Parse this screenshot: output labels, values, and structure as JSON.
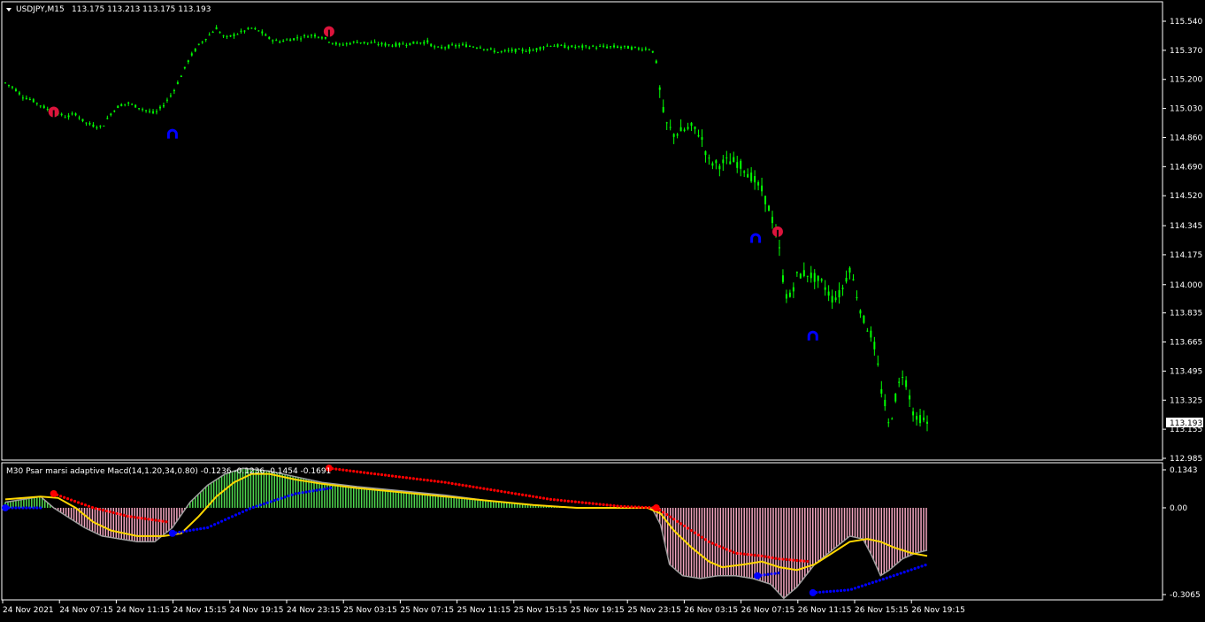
{
  "main_panel": {
    "title": "USDJPY,M15",
    "ohlc": "113.175 113.213 113.175 113.193",
    "current_price": "113.193",
    "y_labels": [
      "115.540",
      "115.370",
      "115.200",
      "115.030",
      "114.860",
      "114.690",
      "114.520",
      "114.345",
      "114.175",
      "114.000",
      "113.835",
      "113.665",
      "113.495",
      "113.325",
      "113.155",
      "112.985"
    ],
    "candle_color": "#00ff00",
    "signal_sell_color": "#dc143c",
    "signal_buy_color": "#0000ff"
  },
  "indicator_panel": {
    "title": "M30 Psar marsi adaptive Macd(14,1.20,34,0.80) -0.1236 -0.1236 -0.1454 -0.1691",
    "y_labels": [
      "0.1343",
      "0.00",
      "-0.3065"
    ]
  },
  "x_labels": [
    "24 Nov 2021",
    "24 Nov 07:15",
    "24 Nov 11:15",
    "24 Nov 15:15",
    "24 Nov 19:15",
    "24 Nov 23:15",
    "25 Nov 03:15",
    "25 Nov 07:15",
    "25 Nov 11:15",
    "25 Nov 15:15",
    "25 Nov 19:15",
    "25 Nov 23:15",
    "26 Nov 03:15",
    "26 Nov 07:15",
    "26 Nov 11:15",
    "26 Nov 15:15",
    "26 Nov 19:15"
  ],
  "colors": {
    "frame": "#ffffff",
    "hist_positive": "#4fd84f",
    "hist_negative": "#f4a6c0",
    "macd_line": "#9e9e9e",
    "signal_line": "#ffd700",
    "psar_red": "#ff0000",
    "psar_blue": "#0000ff"
  },
  "chart_data": [
    {
      "type": "candlestick",
      "title": "USDJPY,M15",
      "ylim": [
        112.985,
        115.54
      ],
      "price_path": [
        [
          0,
          115.18
        ],
        [
          10,
          115.15
        ],
        [
          20,
          115.1
        ],
        [
          30,
          115.08
        ],
        [
          40,
          115.05
        ],
        [
          50,
          115.02
        ],
        [
          60,
          115.0
        ],
        [
          70,
          114.98
        ],
        [
          80,
          115.0
        ],
        [
          90,
          114.95
        ],
        [
          100,
          114.93
        ],
        [
          110,
          114.92
        ],
        [
          120,
          115.0
        ],
        [
          130,
          115.05
        ],
        [
          140,
          115.06
        ],
        [
          150,
          115.04
        ],
        [
          160,
          115.02
        ],
        [
          170,
          115.0
        ],
        [
          180,
          115.05
        ],
        [
          190,
          115.12
        ],
        [
          200,
          115.22
        ],
        [
          210,
          115.33
        ],
        [
          220,
          115.4
        ],
        [
          230,
          115.45
        ],
        [
          240,
          115.5
        ],
        [
          250,
          115.44
        ],
        [
          260,
          115.46
        ],
        [
          270,
          115.48
        ],
        [
          280,
          115.5
        ],
        [
          290,
          115.48
        ],
        [
          300,
          115.44
        ],
        [
          310,
          115.42
        ],
        [
          320,
          115.43
        ],
        [
          330,
          115.44
        ],
        [
          340,
          115.45
        ],
        [
          350,
          115.46
        ],
        [
          360,
          115.45
        ],
        [
          370,
          115.42
        ],
        [
          380,
          115.4
        ],
        [
          390,
          115.41
        ],
        [
          400,
          115.42
        ],
        [
          420,
          115.41
        ],
        [
          440,
          115.4
        ],
        [
          460,
          115.41
        ],
        [
          480,
          115.42
        ],
        [
          490,
          115.38
        ],
        [
          500,
          115.39
        ],
        [
          520,
          115.4
        ],
        [
          540,
          115.39
        ],
        [
          560,
          115.36
        ],
        [
          580,
          115.37
        ],
        [
          600,
          115.37
        ],
        [
          610,
          115.39
        ],
        [
          620,
          115.4
        ],
        [
          640,
          115.39
        ],
        [
          660,
          115.39
        ],
        [
          680,
          115.39
        ],
        [
          700,
          115.39
        ],
        [
          720,
          115.38
        ],
        [
          735,
          115.38
        ],
        [
          740,
          115.3
        ],
        [
          745,
          115.1
        ],
        [
          750,
          114.95
        ],
        [
          760,
          114.88
        ],
        [
          770,
          114.9
        ],
        [
          780,
          114.92
        ],
        [
          790,
          114.88
        ],
        [
          800,
          114.72
        ],
        [
          810,
          114.7
        ],
        [
          820,
          114.72
        ],
        [
          830,
          114.72
        ],
        [
          840,
          114.68
        ],
        [
          850,
          114.62
        ],
        [
          860,
          114.55
        ],
        [
          870,
          114.42
        ],
        [
          875,
          114.32
        ],
        [
          880,
          114.2
        ],
        [
          885,
          114.0
        ],
        [
          890,
          113.9
        ],
        [
          900,
          114.05
        ],
        [
          910,
          114.07
        ],
        [
          920,
          114.04
        ],
        [
          930,
          114.0
        ],
        [
          940,
          113.92
        ],
        [
          950,
          113.95
        ],
        [
          960,
          114.1
        ],
        [
          965,
          114.0
        ],
        [
          975,
          113.8
        ],
        [
          985,
          113.7
        ],
        [
          990,
          113.6
        ],
        [
          995,
          113.4
        ],
        [
          1000,
          113.3
        ],
        [
          1005,
          113.15
        ],
        [
          1010,
          113.3
        ],
        [
          1015,
          113.4
        ],
        [
          1020,
          113.48
        ],
        [
          1025,
          113.42
        ],
        [
          1030,
          113.3
        ],
        [
          1035,
          113.2
        ],
        [
          1040,
          113.22
        ],
        [
          1048,
          113.19
        ]
      ]
    },
    {
      "type": "line",
      "title": "M30 Psar marsi adaptive Macd(14,1.20,34,0.80)",
      "ylim": [
        -0.3065,
        0.1343
      ],
      "series": [
        {
          "role": "histogram",
          "points": [
            [
              0,
              0.02
            ],
            [
              40,
              0.04
            ],
            [
              55,
              0.0
            ],
            [
              70,
              -0.03
            ],
            [
              90,
              -0.07
            ],
            [
              110,
              -0.1
            ],
            [
              130,
              -0.11
            ],
            [
              150,
              -0.12
            ],
            [
              170,
              -0.12
            ],
            [
              190,
              -0.07
            ],
            [
              210,
              0.02
            ],
            [
              230,
              0.08
            ],
            [
              250,
              0.12
            ],
            [
              270,
              0.14
            ],
            [
              300,
              0.13
            ],
            [
              330,
              0.11
            ],
            [
              360,
              0.09
            ],
            [
              400,
              0.075
            ],
            [
              450,
              0.06
            ],
            [
              500,
              0.045
            ],
            [
              550,
              0.025
            ],
            [
              600,
              0.01
            ],
            [
              650,
              0.0
            ],
            [
              700,
              0.0
            ],
            [
              735,
              0.0
            ],
            [
              745,
              -0.06
            ],
            [
              755,
              -0.2
            ],
            [
              770,
              -0.24
            ],
            [
              790,
              -0.25
            ],
            [
              810,
              -0.24
            ],
            [
              830,
              -0.24
            ],
            [
              850,
              -0.25
            ],
            [
              870,
              -0.27
            ],
            [
              885,
              -0.32
            ],
            [
              900,
              -0.28
            ],
            [
              920,
              -0.2
            ],
            [
              940,
              -0.15
            ],
            [
              960,
              -0.1
            ],
            [
              975,
              -0.11
            ],
            [
              985,
              -0.17
            ],
            [
              995,
              -0.24
            ],
            [
              1005,
              -0.22
            ],
            [
              1020,
              -0.18
            ],
            [
              1035,
              -0.16
            ],
            [
              1048,
              -0.15
            ]
          ]
        },
        {
          "role": "macd",
          "points": [
            [
              0,
              0.02
            ],
            [
              40,
              0.04
            ],
            [
              55,
              0.0
            ],
            [
              70,
              -0.03
            ],
            [
              90,
              -0.07
            ],
            [
              110,
              -0.1
            ],
            [
              130,
              -0.11
            ],
            [
              150,
              -0.12
            ],
            [
              170,
              -0.12
            ],
            [
              190,
              -0.07
            ],
            [
              210,
              0.02
            ],
            [
              230,
              0.08
            ],
            [
              250,
              0.12
            ],
            [
              270,
              0.14
            ],
            [
              300,
              0.13
            ],
            [
              330,
              0.11
            ],
            [
              360,
              0.09
            ],
            [
              400,
              0.075
            ],
            [
              450,
              0.06
            ],
            [
              500,
              0.045
            ],
            [
              550,
              0.025
            ],
            [
              600,
              0.01
            ],
            [
              650,
              0.0
            ],
            [
              700,
              0.0
            ],
            [
              735,
              0.0
            ],
            [
              745,
              -0.06
            ],
            [
              755,
              -0.2
            ],
            [
              770,
              -0.24
            ],
            [
              790,
              -0.25
            ],
            [
              810,
              -0.24
            ],
            [
              830,
              -0.24
            ],
            [
              850,
              -0.25
            ],
            [
              870,
              -0.27
            ],
            [
              885,
              -0.32
            ],
            [
              900,
              -0.28
            ],
            [
              920,
              -0.2
            ],
            [
              940,
              -0.15
            ],
            [
              960,
              -0.1
            ],
            [
              975,
              -0.11
            ],
            [
              985,
              -0.17
            ],
            [
              995,
              -0.24
            ],
            [
              1005,
              -0.22
            ],
            [
              1020,
              -0.18
            ],
            [
              1035,
              -0.16
            ],
            [
              1048,
              -0.15
            ]
          ]
        },
        {
          "role": "signal",
          "points": [
            [
              0,
              0.03
            ],
            [
              40,
              0.04
            ],
            [
              60,
              0.035
            ],
            [
              80,
              0.0
            ],
            [
              100,
              -0.05
            ],
            [
              120,
              -0.08
            ],
            [
              150,
              -0.1
            ],
            [
              180,
              -0.1
            ],
            [
              200,
              -0.09
            ],
            [
              220,
              -0.03
            ],
            [
              240,
              0.04
            ],
            [
              260,
              0.09
            ],
            [
              280,
              0.12
            ],
            [
              300,
              0.12
            ],
            [
              330,
              0.1
            ],
            [
              360,
              0.085
            ],
            [
              400,
              0.07
            ],
            [
              450,
              0.055
            ],
            [
              500,
              0.04
            ],
            [
              550,
              0.025
            ],
            [
              600,
              0.01
            ],
            [
              650,
              0.0
            ],
            [
              730,
              0.0
            ],
            [
              745,
              -0.02
            ],
            [
              760,
              -0.08
            ],
            [
              780,
              -0.14
            ],
            [
              800,
              -0.19
            ],
            [
              815,
              -0.21
            ],
            [
              840,
              -0.2
            ],
            [
              860,
              -0.19
            ],
            [
              880,
              -0.21
            ],
            [
              900,
              -0.22
            ],
            [
              920,
              -0.2
            ],
            [
              940,
              -0.16
            ],
            [
              960,
              -0.12
            ],
            [
              980,
              -0.11
            ],
            [
              995,
              -0.12
            ],
            [
              1010,
              -0.14
            ],
            [
              1030,
              -0.16
            ],
            [
              1048,
              -0.17
            ]
          ]
        },
        {
          "role": "psar_red",
          "segments": [
            [
              [
                55,
                0.05
              ],
              [
                100,
                0.0
              ],
              [
                140,
                -0.03
              ],
              [
                185,
                -0.05
              ]
            ],
            [
              [
                368,
                0.14
              ],
              [
                420,
                0.12
              ],
              [
                500,
                0.09
              ],
              [
                560,
                0.06
              ],
              [
                620,
                0.03
              ],
              [
                700,
                0.005
              ],
              [
                740,
                0.0
              ]
            ],
            [
              [
                740,
                0.0
              ],
              [
                770,
                -0.06
              ],
              [
                800,
                -0.12
              ],
              [
                830,
                -0.16
              ],
              [
                860,
                -0.17
              ],
              [
                878,
                -0.18
              ],
              [
                915,
                -0.19
              ]
            ]
          ]
        },
        {
          "role": "psar_blue",
          "segments": [
            [
              [
                0,
                0.0
              ],
              [
                40,
                0.0
              ]
            ],
            [
              [
                190,
                -0.09
              ],
              [
                230,
                -0.07
              ],
              [
                280,
                0.0
              ],
              [
                330,
                0.05
              ],
              [
                370,
                0.07
              ]
            ],
            [
              [
                855,
                -0.24
              ],
              [
                880,
                -0.23
              ]
            ],
            [
              [
                918,
                -0.3
              ],
              [
                960,
                -0.29
              ],
              [
                1000,
                -0.25
              ],
              [
                1048,
                -0.2
              ]
            ]
          ]
        }
      ]
    }
  ],
  "signals": [
    {
      "kind": "sell",
      "x": 55,
      "price": 115.01
    },
    {
      "kind": "buy",
      "x": 190,
      "price": 114.88
    },
    {
      "kind": "sell",
      "x": 368,
      "price": 115.48
    },
    {
      "kind": "buy",
      "x": 853,
      "price": 114.27
    },
    {
      "kind": "sell",
      "x": 878,
      "price": 114.31
    },
    {
      "kind": "buy",
      "x": 918,
      "price": 113.7
    }
  ]
}
